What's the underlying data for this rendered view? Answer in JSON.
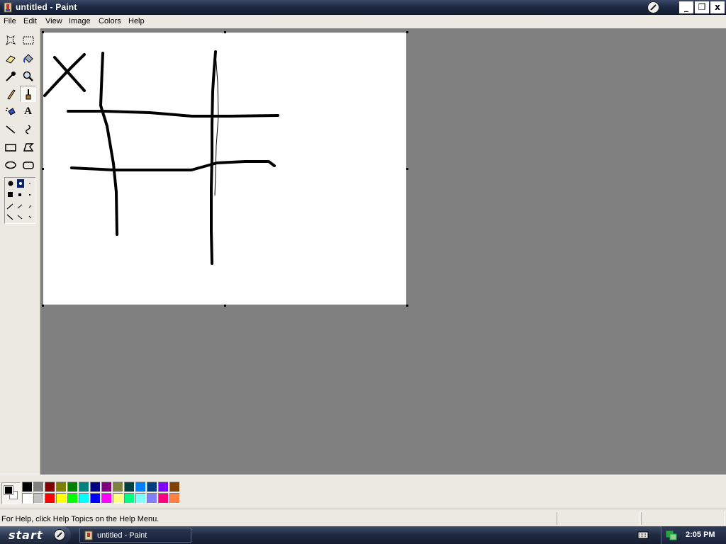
{
  "window": {
    "title": "untitled - Paint",
    "buttons": {
      "minimize": "_",
      "restore": "❐",
      "close": "x"
    }
  },
  "menu": [
    "File",
    "Edit",
    "View",
    "Image",
    "Colors",
    "Help"
  ],
  "tools": [
    {
      "name": "free-form-select-tool",
      "icon": "free-form-select-icon"
    },
    {
      "name": "rect-select-tool",
      "icon": "rect-select-icon"
    },
    {
      "name": "eraser-tool",
      "icon": "eraser-icon"
    },
    {
      "name": "fill-tool",
      "icon": "fill-bucket-icon"
    },
    {
      "name": "pick-color-tool",
      "icon": "eyedropper-icon"
    },
    {
      "name": "magnifier-tool",
      "icon": "magnifier-icon"
    },
    {
      "name": "pencil-tool",
      "icon": "pencil-icon"
    },
    {
      "name": "brush-tool",
      "icon": "brush-icon",
      "active": true
    },
    {
      "name": "airbrush-tool",
      "icon": "airbrush-icon"
    },
    {
      "name": "text-tool",
      "icon": "text-icon",
      "glyph": "A"
    },
    {
      "name": "line-tool",
      "icon": "line-icon"
    },
    {
      "name": "curve-tool",
      "icon": "curve-icon"
    },
    {
      "name": "rectangle-tool",
      "icon": "rectangle-icon"
    },
    {
      "name": "polygon-tool",
      "icon": "polygon-icon"
    },
    {
      "name": "ellipse-tool",
      "icon": "ellipse-icon"
    },
    {
      "name": "rounded-rectangle-tool",
      "icon": "rounded-rectangle-icon"
    }
  ],
  "colors": {
    "foreground": "#000000",
    "background": "#ffffff",
    "palette_row1": [
      "#000000",
      "#808080",
      "#800000",
      "#808000",
      "#008000",
      "#008080",
      "#000080",
      "#800080",
      "#808040",
      "#004040",
      "#0080ff",
      "#004080",
      "#8000ff",
      "#804000"
    ],
    "palette_row2": [
      "#ffffff",
      "#c0c0c0",
      "#ff0000",
      "#ffff00",
      "#00ff00",
      "#00ffff",
      "#0000ff",
      "#ff00ff",
      "#ffff80",
      "#00ff80",
      "#80ffff",
      "#8080ff",
      "#ff0080",
      "#ff8040"
    ]
  },
  "status": {
    "help_text": "For Help, click Help Topics on the Help Menu."
  },
  "taskbar": {
    "start_label": "start",
    "task_label": "untitled - Paint",
    "clock": "2:05 PM"
  }
}
